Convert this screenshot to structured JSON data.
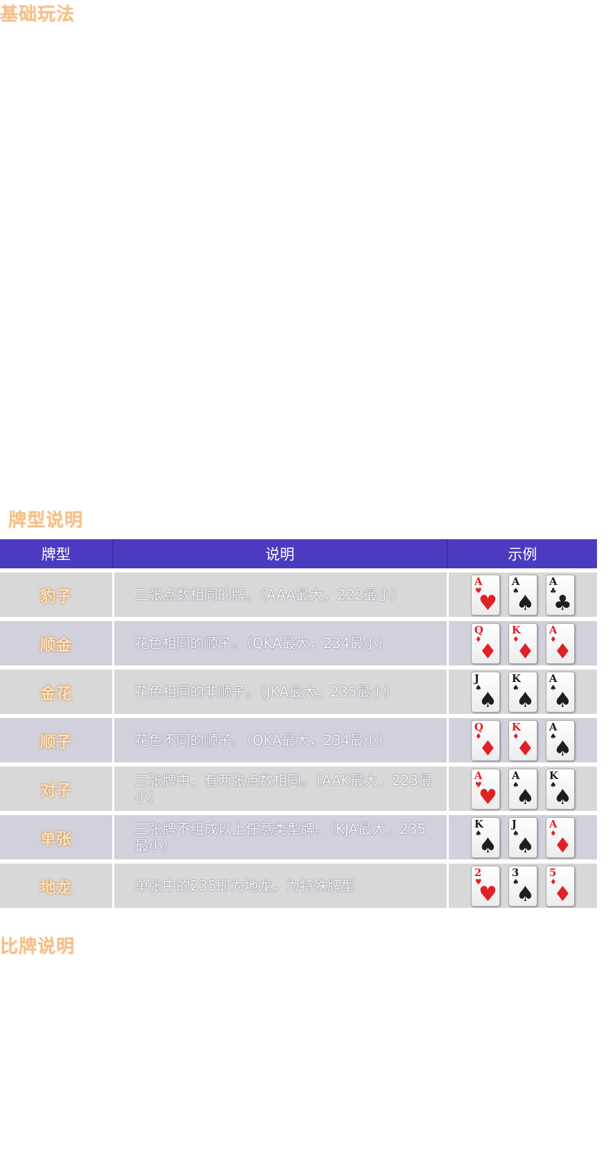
{
  "sections": {
    "basic_title": "基础玩法",
    "types_title": "牌型说明",
    "compare_title": "比牌说明"
  },
  "table": {
    "headers": [
      "牌型",
      "说明",
      "示例"
    ],
    "rows": [
      {
        "type": "豹子",
        "desc": "三张点数相同的牌。（AAA最大，222最小）",
        "cards": [
          {
            "rank": "A",
            "suit": "♥",
            "color": "red"
          },
          {
            "rank": "A",
            "suit": "♠",
            "color": "black"
          },
          {
            "rank": "A",
            "suit": "♣",
            "color": "black"
          }
        ]
      },
      {
        "type": "顺金",
        "desc": "花色相同的顺子。（QKA最大，234最小）",
        "cards": [
          {
            "rank": "Q",
            "suit": "♦",
            "color": "red"
          },
          {
            "rank": "K",
            "suit": "♦",
            "color": "red"
          },
          {
            "rank": "A",
            "suit": "♦",
            "color": "red"
          }
        ]
      },
      {
        "type": "金花",
        "desc": "花色相同的非顺子。（JKA最大，235最小）",
        "cards": [
          {
            "rank": "J",
            "suit": "♠",
            "color": "black"
          },
          {
            "rank": "K",
            "suit": "♠",
            "color": "black"
          },
          {
            "rank": "A",
            "suit": "♠",
            "color": "black"
          }
        ]
      },
      {
        "type": "顺子",
        "desc": "花色不同的顺子。（QKA最大，234最小）",
        "cards": [
          {
            "rank": "Q",
            "suit": "♦",
            "color": "red"
          },
          {
            "rank": "K",
            "suit": "♦",
            "color": "red"
          },
          {
            "rank": "A",
            "suit": "♠",
            "color": "black"
          }
        ]
      },
      {
        "type": "对子",
        "desc": "三张牌中，有两张点数相同。（AAK最大，223最小）",
        "cards": [
          {
            "rank": "A",
            "suit": "♥",
            "color": "red"
          },
          {
            "rank": "A",
            "suit": "♠",
            "color": "black"
          },
          {
            "rank": "K",
            "suit": "♠",
            "color": "black"
          }
        ]
      },
      {
        "type": "单张",
        "desc": "三张牌不组成以上任意类型牌。（KJA最大，235最小）",
        "cards": [
          {
            "rank": "K",
            "suit": "♠",
            "color": "black"
          },
          {
            "rank": "J",
            "suit": "♠",
            "color": "black"
          },
          {
            "rank": "A",
            "suit": "♦",
            "color": "red"
          }
        ]
      },
      {
        "type": "地龙",
        "desc": "单张中的235即为地龙，为特殊牌型",
        "cards": [
          {
            "rank": "2",
            "suit": "♥",
            "color": "red"
          },
          {
            "rank": "3",
            "suit": "♠",
            "color": "black"
          },
          {
            "rank": "5",
            "suit": "♦",
            "color": "red"
          }
        ]
      }
    ]
  },
  "colors": {
    "header_bg": "#4b3bc1",
    "title_color": "#f4bf8a",
    "row_odd": "#d8d8d8",
    "row_even": "#d1d1dc"
  }
}
